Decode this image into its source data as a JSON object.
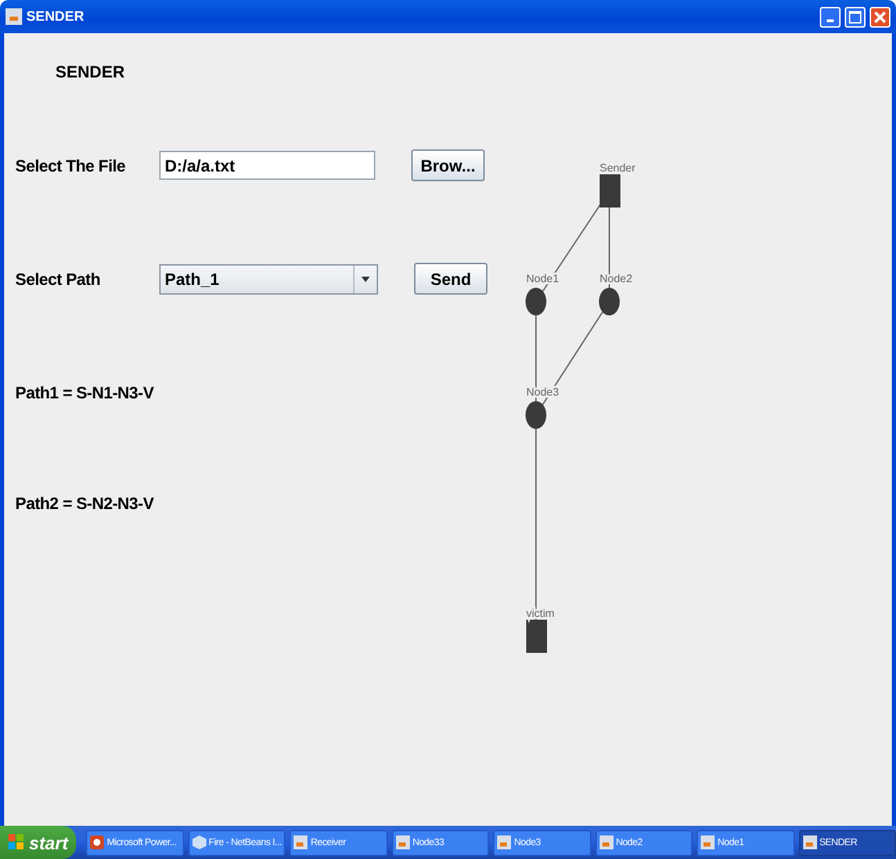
{
  "window": {
    "title": "SENDER"
  },
  "heading": "SENDER",
  "file_row": {
    "label": "Select The File",
    "value": "D:/a/a.txt",
    "button": "Brow..."
  },
  "path_row": {
    "label": "Select Path",
    "value": "Path_1",
    "button": "Send"
  },
  "paths": [
    "Path1 = S-N1-N3-V",
    "Path2 = S-N2-N3-V"
  ],
  "graph": {
    "nodes": [
      {
        "label": "Sender",
        "kind": "square"
      },
      {
        "label": "Node1",
        "kind": "circle"
      },
      {
        "label": "Node2",
        "kind": "circle"
      },
      {
        "label": "Node3",
        "kind": "circle"
      },
      {
        "label": "victim",
        "kind": "square"
      }
    ]
  },
  "taskbar": {
    "start": "start",
    "items": [
      {
        "label": "Microsoft Power...",
        "kind": "powerpoint",
        "selected": false
      },
      {
        "label": "Fire - NetBeans I...",
        "kind": "netbeans",
        "selected": false
      },
      {
        "label": "Receiver",
        "kind": "java",
        "selected": false
      },
      {
        "label": "Node33",
        "kind": "java",
        "selected": false
      },
      {
        "label": "Node3",
        "kind": "java",
        "selected": false
      },
      {
        "label": "Node2",
        "kind": "java",
        "selected": false
      },
      {
        "label": "Node1",
        "kind": "java",
        "selected": false
      },
      {
        "label": "SENDER",
        "kind": "java",
        "selected": true
      }
    ]
  }
}
